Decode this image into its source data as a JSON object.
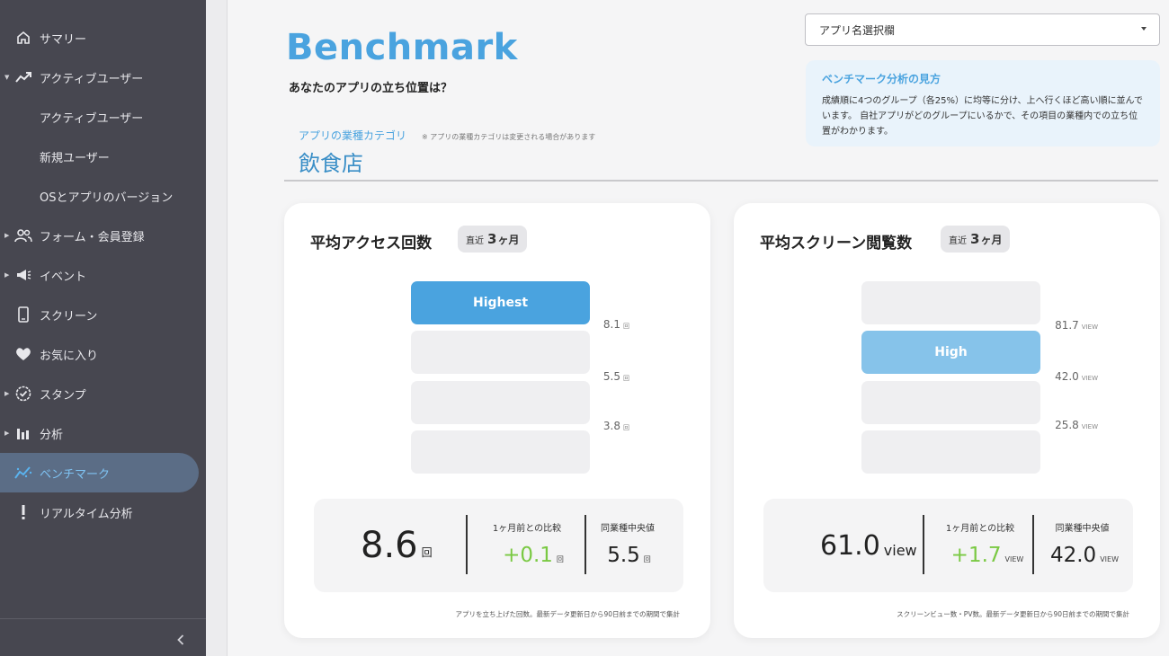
{
  "sidebar": {
    "items": [
      {
        "label": "サマリー",
        "icon": "home-icon",
        "caret": false
      },
      {
        "label": "アクティブユーザー",
        "icon": "trending-up-icon",
        "caret": true,
        "expanded": true
      },
      {
        "label": "アクティブユーザー",
        "sub": true
      },
      {
        "label": "新規ユーザー",
        "sub": true
      },
      {
        "label": "OSとアプリのバージョン",
        "sub": true
      },
      {
        "label": "フォーム・会員登録",
        "icon": "users-icon",
        "caret": true
      },
      {
        "label": "イベント",
        "icon": "megaphone-icon",
        "caret": true
      },
      {
        "label": "スクリーン",
        "icon": "smartphone-icon",
        "caret": false
      },
      {
        "label": "お気に入り",
        "icon": "heart-icon",
        "caret": false
      },
      {
        "label": "スタンプ",
        "icon": "badge-check-icon",
        "caret": true
      },
      {
        "label": "分析",
        "icon": "bar-chart-icon",
        "caret": true
      },
      {
        "label": "ベンチマーク",
        "icon": "benchmark-icon",
        "caret": false,
        "active": true
      },
      {
        "label": "リアルタイム分析",
        "icon": "exclamation-icon",
        "caret": false
      }
    ],
    "collapse_icon": "chevron-left-icon"
  },
  "header": {
    "title": "Benchmark",
    "subtitle": "あなたのアプリの立ち位置は？",
    "category_label": "アプリの業種カテゴリ",
    "category_note": "※ アプリの業種カテゴリは変更される場合があります",
    "category_value": "飲食店"
  },
  "app_select": {
    "value": "アプリ名選択欄"
  },
  "info": {
    "title": "ベンチマーク分析の見方",
    "body": "成績順に4つのグループ（各25%）に均等に分け、上へ行くほど高い順に並んでいます。 自社アプリがどのグループにいるかで、その項目の業種内での立ち位置がわかります。"
  },
  "period": {
    "prefix": "直近",
    "num": "3",
    "unit": "ヶ月"
  },
  "cards": [
    {
      "title": "平均アクセス回数",
      "tiers": [
        {
          "label": "Highest",
          "highlight": true
        },
        {
          "label": "",
          "highlight": false
        },
        {
          "label": "",
          "highlight": false
        },
        {
          "label": "",
          "highlight": false
        }
      ],
      "thresholds": [
        {
          "value": "8.1",
          "unit": "回"
        },
        {
          "value": "5.5",
          "unit": "回"
        },
        {
          "value": "3.8",
          "unit": "回"
        }
      ],
      "value": "8.6",
      "value_unit": "回",
      "compare_label": "1ヶ月前との比較",
      "compare_value": "+0.1",
      "compare_unit": "回",
      "median_label": "同業種中央値",
      "median_value": "5.5",
      "median_unit": "回",
      "footnote": "アプリを立ち上げた回数。最新データ更新日から90日前までの期間で集計"
    },
    {
      "title": "平均スクリーン閲覧数",
      "tiers": [
        {
          "label": "",
          "highlight": false
        },
        {
          "label": "High",
          "highlight": true
        },
        {
          "label": "",
          "highlight": false
        },
        {
          "label": "",
          "highlight": false
        }
      ],
      "thresholds": [
        {
          "value": "81.7",
          "unit": "VIEW"
        },
        {
          "value": "42.0",
          "unit": "VIEW"
        },
        {
          "value": "25.8",
          "unit": "VIEW"
        }
      ],
      "value": "61.0",
      "value_unit": "view",
      "compare_label": "1ヶ月前との比較",
      "compare_value": "+1.7",
      "compare_unit": "VIEW",
      "median_label": "同業種中央値",
      "median_value": "42.0",
      "median_unit": "VIEW",
      "footnote": "スクリーンビュー数・PV数。最新データ更新日から90日前までの期間で集計"
    }
  ],
  "colors": {
    "accent": "#4aa3df",
    "accent_light": "#86c3ea",
    "positive": "#7ac943",
    "sidebar": "#474750"
  }
}
